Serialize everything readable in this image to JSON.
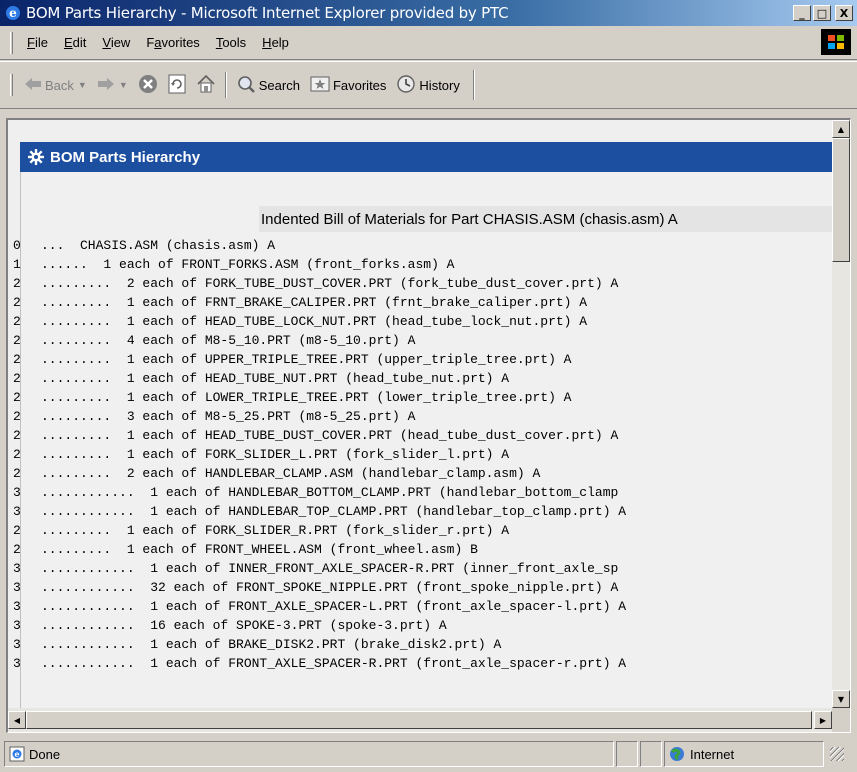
{
  "window": {
    "title": "BOM Parts Hierarchy - Microsoft Internet Explorer provided by PTC",
    "minimize": "_",
    "maximize": "□",
    "close": "X"
  },
  "menu": {
    "items": [
      {
        "key": "F",
        "rest": "ile"
      },
      {
        "key": "E",
        "rest": "dit"
      },
      {
        "key": "V",
        "rest": "iew"
      },
      {
        "pre": "F",
        "key": "a",
        "rest": "vorites"
      },
      {
        "key": "T",
        "rest": "ools"
      },
      {
        "key": "H",
        "rest": "elp"
      }
    ]
  },
  "toolbar": {
    "back": "Back",
    "search": "Search",
    "favorites": "Favorites",
    "history": "History"
  },
  "panel": {
    "header": "BOM Parts Hierarchy",
    "bom_title": "Indented Bill of Materials for Part CHASIS.ASM (chasis.asm) A",
    "rows": [
      {
        "level": "0",
        "text": "...  CHASIS.ASM (chasis.asm) A"
      },
      {
        "level": "1",
        "text": "......  1 each of FRONT_FORKS.ASM (front_forks.asm) A"
      },
      {
        "level": "2",
        "text": ".........  2 each of FORK_TUBE_DUST_COVER.PRT (fork_tube_dust_cover.prt) A"
      },
      {
        "level": "2",
        "text": ".........  1 each of FRNT_BRAKE_CALIPER.PRT (frnt_brake_caliper.prt) A"
      },
      {
        "level": "2",
        "text": ".........  1 each of HEAD_TUBE_LOCK_NUT.PRT (head_tube_lock_nut.prt) A"
      },
      {
        "level": "2",
        "text": ".........  4 each of M8-5_10.PRT (m8-5_10.prt) A"
      },
      {
        "level": "2",
        "text": ".........  1 each of UPPER_TRIPLE_TREE.PRT (upper_triple_tree.prt) A"
      },
      {
        "level": "2",
        "text": ".........  1 each of HEAD_TUBE_NUT.PRT (head_tube_nut.prt) A"
      },
      {
        "level": "2",
        "text": ".........  1 each of LOWER_TRIPLE_TREE.PRT (lower_triple_tree.prt) A"
      },
      {
        "level": "2",
        "text": ".........  3 each of M8-5_25.PRT (m8-5_25.prt) A"
      },
      {
        "level": "2",
        "text": ".........  1 each of HEAD_TUBE_DUST_COVER.PRT (head_tube_dust_cover.prt) A"
      },
      {
        "level": "2",
        "text": ".........  1 each of FORK_SLIDER_L.PRT (fork_slider_l.prt) A"
      },
      {
        "level": "2",
        "text": ".........  2 each of HANDLEBAR_CLAMP.ASM (handlebar_clamp.asm) A"
      },
      {
        "level": "3",
        "text": "............  1 each of HANDLEBAR_BOTTOM_CLAMP.PRT (handlebar_bottom_clamp"
      },
      {
        "level": "3",
        "text": "............  1 each of HANDLEBAR_TOP_CLAMP.PRT (handlebar_top_clamp.prt) A"
      },
      {
        "level": "2",
        "text": ".........  1 each of FORK_SLIDER_R.PRT (fork_slider_r.prt) A"
      },
      {
        "level": "2",
        "text": ".........  1 each of FRONT_WHEEL.ASM (front_wheel.asm) B"
      },
      {
        "level": "3",
        "text": "............  1 each of INNER_FRONT_AXLE_SPACER-R.PRT (inner_front_axle_sp"
      },
      {
        "level": "3",
        "text": "............  32 each of FRONT_SPOKE_NIPPLE.PRT (front_spoke_nipple.prt) A"
      },
      {
        "level": "3",
        "text": "............  1 each of FRONT_AXLE_SPACER-L.PRT (front_axle_spacer-l.prt) A"
      },
      {
        "level": "3",
        "text": "............  16 each of SPOKE-3.PRT (spoke-3.prt) A"
      },
      {
        "level": "3",
        "text": "............  1 each of BRAKE_DISK2.PRT (brake_disk2.prt) A"
      },
      {
        "level": "3",
        "text": "............  1 each of FRONT_AXLE_SPACER-R.PRT (front_axle_spacer-r.prt) A"
      }
    ]
  },
  "status": {
    "left": "Done",
    "zone": "Internet"
  }
}
